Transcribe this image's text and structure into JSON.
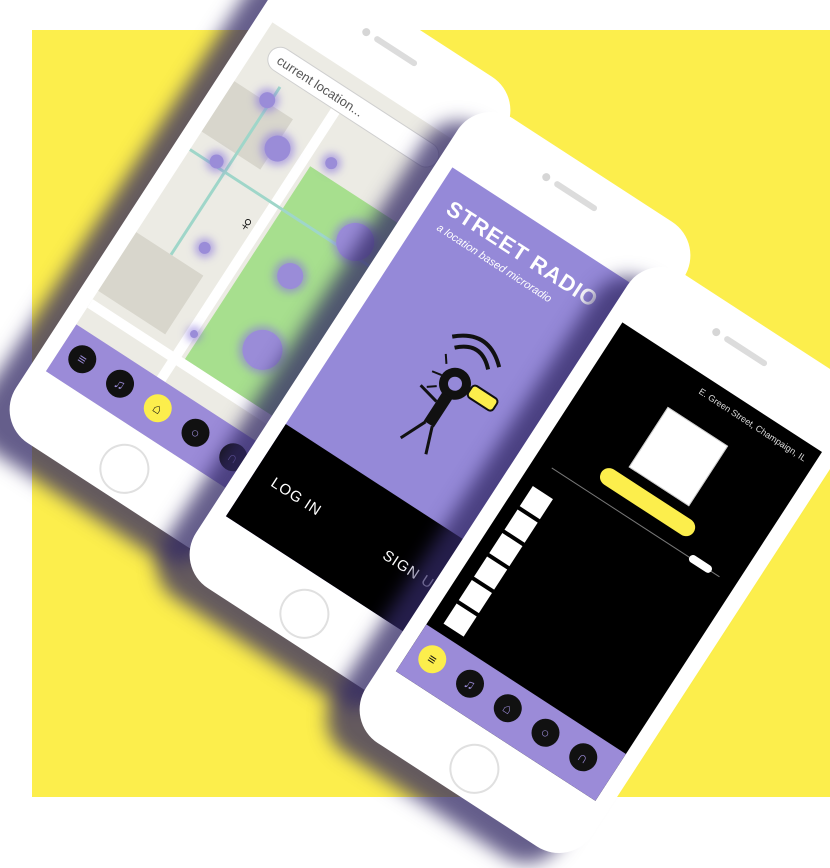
{
  "colors": {
    "background": "#FCEE4C",
    "accent_purple": "#9589d8",
    "nav_purple": "#9b8bd8",
    "highlight_yellow": "#FCEE4C",
    "screen_black": "#000000"
  },
  "map_screen": {
    "search_placeholder": "current location...",
    "nav_icons": [
      "list-icon",
      "broadcast-person-icon",
      "home-icon",
      "record-icon",
      "headphones-icon"
    ],
    "active_nav": "home-icon"
  },
  "landing_screen": {
    "title": "STREET RADIO",
    "subtitle": "a location based microradio",
    "login_label": "LOG IN",
    "signup_label": "SIGN UP"
  },
  "player_screen": {
    "location": "E. Green Street, Champaign, IL",
    "pill_label": "",
    "list_title": "",
    "tracks": [
      {
        "text": ""
      },
      {
        "text": ""
      },
      {
        "text": ""
      },
      {
        "text": ""
      },
      {
        "text": ""
      },
      {
        "text": ""
      }
    ],
    "nav_icons": [
      "list-icon",
      "broadcast-person-icon",
      "home-icon",
      "record-icon",
      "headphones-icon"
    ],
    "active_nav": "list-icon"
  }
}
